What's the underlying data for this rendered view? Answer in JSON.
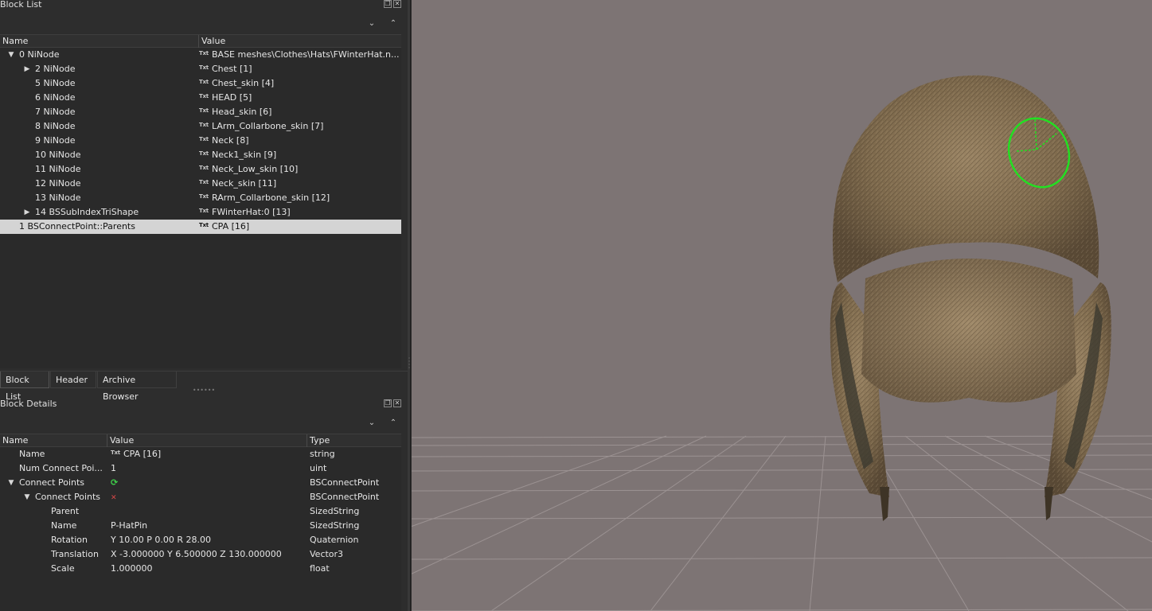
{
  "block_list": {
    "title": "Block List",
    "columns": [
      "Name",
      "Value"
    ],
    "rows": [
      {
        "name": "0 NiNode",
        "value": "BASE meshes\\Clothes\\Hats\\FWinterHat.n...",
        "level": 0,
        "arrow": "down"
      },
      {
        "name": "2 NiNode",
        "value": "Chest [1]",
        "level": 1,
        "arrow": "right"
      },
      {
        "name": "5 NiNode",
        "value": "Chest_skin [4]",
        "level": 1,
        "arrow": ""
      },
      {
        "name": "6 NiNode",
        "value": "HEAD [5]",
        "level": 1,
        "arrow": ""
      },
      {
        "name": "7 NiNode",
        "value": "Head_skin [6]",
        "level": 1,
        "arrow": ""
      },
      {
        "name": "8 NiNode",
        "value": "LArm_Collarbone_skin [7]",
        "level": 1,
        "arrow": ""
      },
      {
        "name": "9 NiNode",
        "value": "Neck [8]",
        "level": 1,
        "arrow": ""
      },
      {
        "name": "10 NiNode",
        "value": "Neck1_skin [9]",
        "level": 1,
        "arrow": ""
      },
      {
        "name": "11 NiNode",
        "value": "Neck_Low_skin [10]",
        "level": 1,
        "arrow": ""
      },
      {
        "name": "12 NiNode",
        "value": "Neck_skin [11]",
        "level": 1,
        "arrow": ""
      },
      {
        "name": "13 NiNode",
        "value": "RArm_Collarbone_skin [12]",
        "level": 1,
        "arrow": ""
      },
      {
        "name": "14 BSSubIndexTriShape",
        "value": "FWinterHat:0 [13]",
        "level": 1,
        "arrow": "right"
      },
      {
        "name": "1 BSConnectPoint::Parents",
        "value": "CPA [16]",
        "level": 0,
        "arrow": "",
        "selected": true
      }
    ]
  },
  "tabs": [
    "Block List",
    "Header",
    "Archive Browser"
  ],
  "block_details": {
    "title": "Block Details",
    "columns": [
      "Name",
      "Value",
      "Type"
    ],
    "rows": [
      {
        "name": "Name",
        "value": "CPA [16]",
        "type": "string",
        "level": 1,
        "icon": "txt"
      },
      {
        "name": "Num Connect Poi...",
        "value": "1",
        "type": "uint",
        "level": 1,
        "icon": ""
      },
      {
        "name": "Connect Points",
        "value": "",
        "type": "BSConnectPoint",
        "level": 1,
        "arrow": "down",
        "icon": "refresh"
      },
      {
        "name": "Connect Points",
        "value": "",
        "type": "BSConnectPoint",
        "level": 2,
        "arrow": "down",
        "icon": "axes"
      },
      {
        "name": "Parent",
        "value": "",
        "type": "SizedString",
        "level": 3,
        "icon": ""
      },
      {
        "name": "Name",
        "value": "P-HatPin",
        "type": "SizedString",
        "level": 3,
        "icon": ""
      },
      {
        "name": "Rotation",
        "value": "Y 10.00 P 0.00 R 28.00",
        "type": "Quaternion",
        "level": 3,
        "icon": ""
      },
      {
        "name": "Translation",
        "value": "X -3.000000 Y 6.500000 Z 130.000000",
        "type": "Vector3",
        "level": 3,
        "icon": ""
      },
      {
        "name": "Scale",
        "value": "1.000000",
        "type": "float",
        "level": 3,
        "icon": ""
      }
    ]
  },
  "colors": {
    "viewport_bg": "#7d7474",
    "selection": "#d4d4d4",
    "gizmo": "#22e022"
  }
}
